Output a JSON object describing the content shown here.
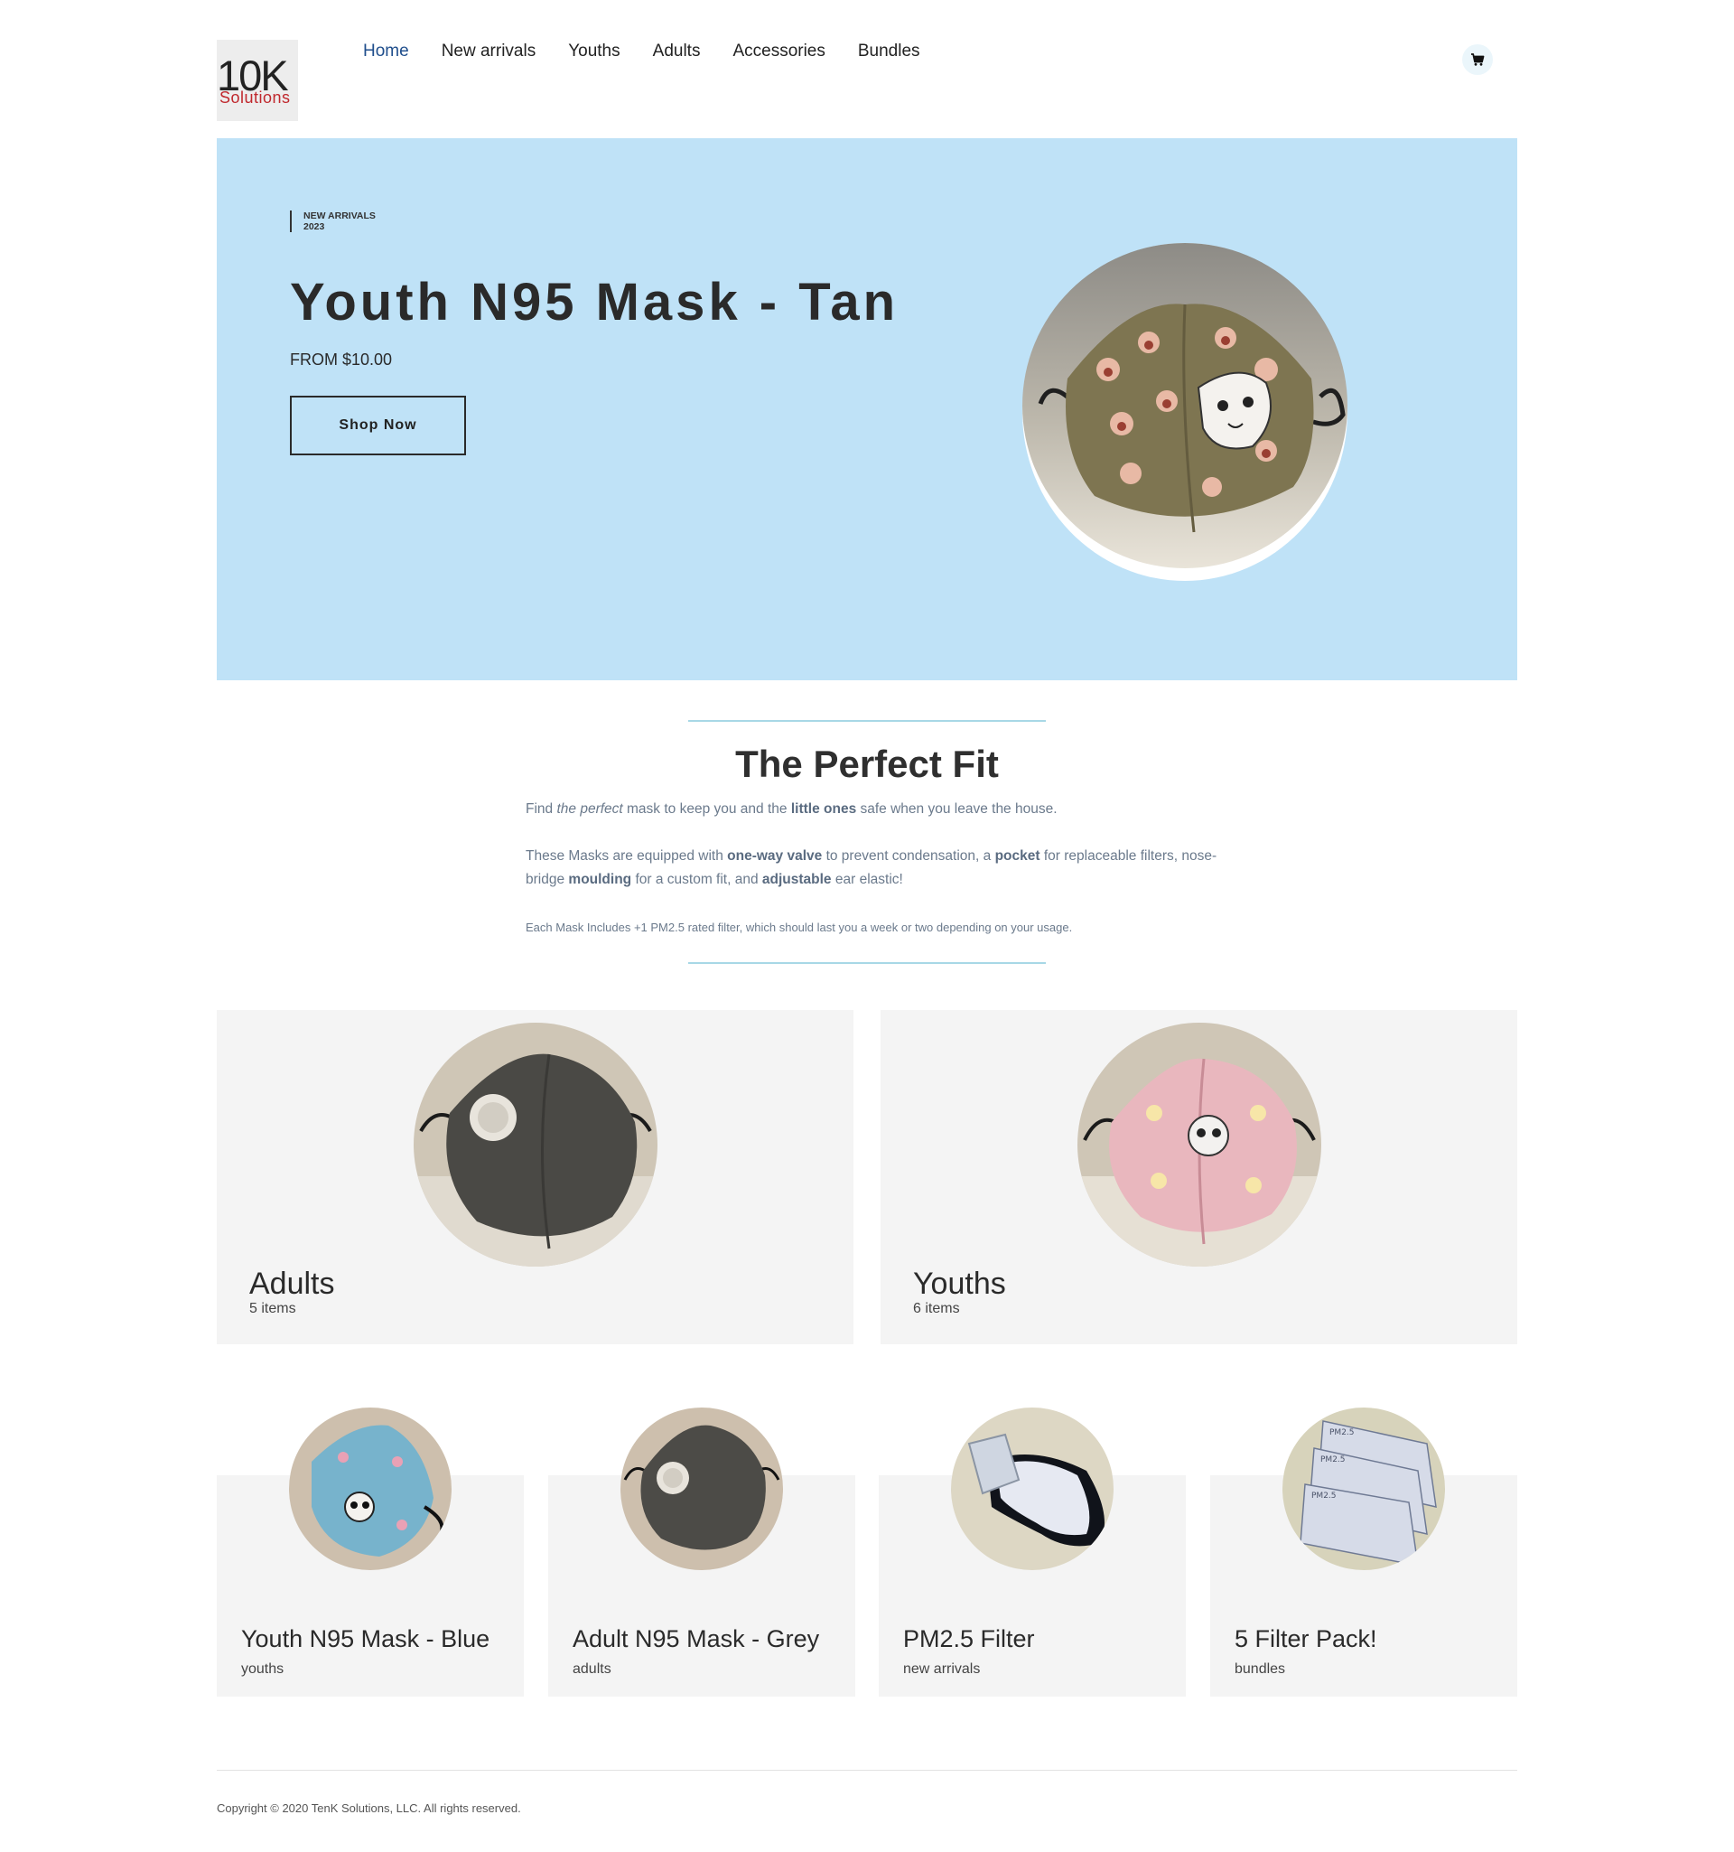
{
  "logo": {
    "main": "10K",
    "sub": "Solutions"
  },
  "nav": {
    "items": [
      {
        "label": "Home"
      },
      {
        "label": "New arrivals"
      },
      {
        "label": "Youths"
      },
      {
        "label": "Adults"
      },
      {
        "label": "Accessories"
      },
      {
        "label": "Bundles"
      }
    ],
    "active": "Home",
    "cart_icon": "cart-icon"
  },
  "hero": {
    "tagline_line1": "NEW ARRIVALS",
    "tagline_line2": "2023",
    "title": "Youth N95 Mask - Tan",
    "price": "FROM $10.00",
    "cta": "Shop Now",
    "background": "#bfe2f7"
  },
  "fit": {
    "title": "The Perfect Fit",
    "p1": {
      "a": "Find ",
      "b": "the perfect",
      "c": " mask to keep you and the ",
      "d": "little ones",
      "e": " safe when you leave the house."
    },
    "p2": {
      "a": "These Masks are equipped with ",
      "b": "one-way valve",
      "c": " to prevent condensation, a ",
      "d": "pocket",
      "e": " for replaceable filters, nose-bridge ",
      "f": "moulding",
      "g": " for a custom fit, and ",
      "h": "adjustable",
      "i": " ear elastic!"
    },
    "p3": "Each Mask Includes +1 PM2.5 rated filter, which should last you a week or two depending on your usage."
  },
  "categories": [
    {
      "name": "Adults",
      "count": "5 items"
    },
    {
      "name": "Youths",
      "count": "6 items"
    }
  ],
  "products": [
    {
      "name": "Youth N95 Mask - Blue",
      "category": "youths"
    },
    {
      "name": "Adult N95 Mask - Grey",
      "category": "adults"
    },
    {
      "name": "PM2.5 Filter",
      "category": "new arrivals"
    },
    {
      "name": "5 Filter Pack!",
      "category": "bundles"
    }
  ],
  "footer": {
    "copyright": "Copyright © 2020 TenK Solutions, LLC. All rights reserved."
  }
}
